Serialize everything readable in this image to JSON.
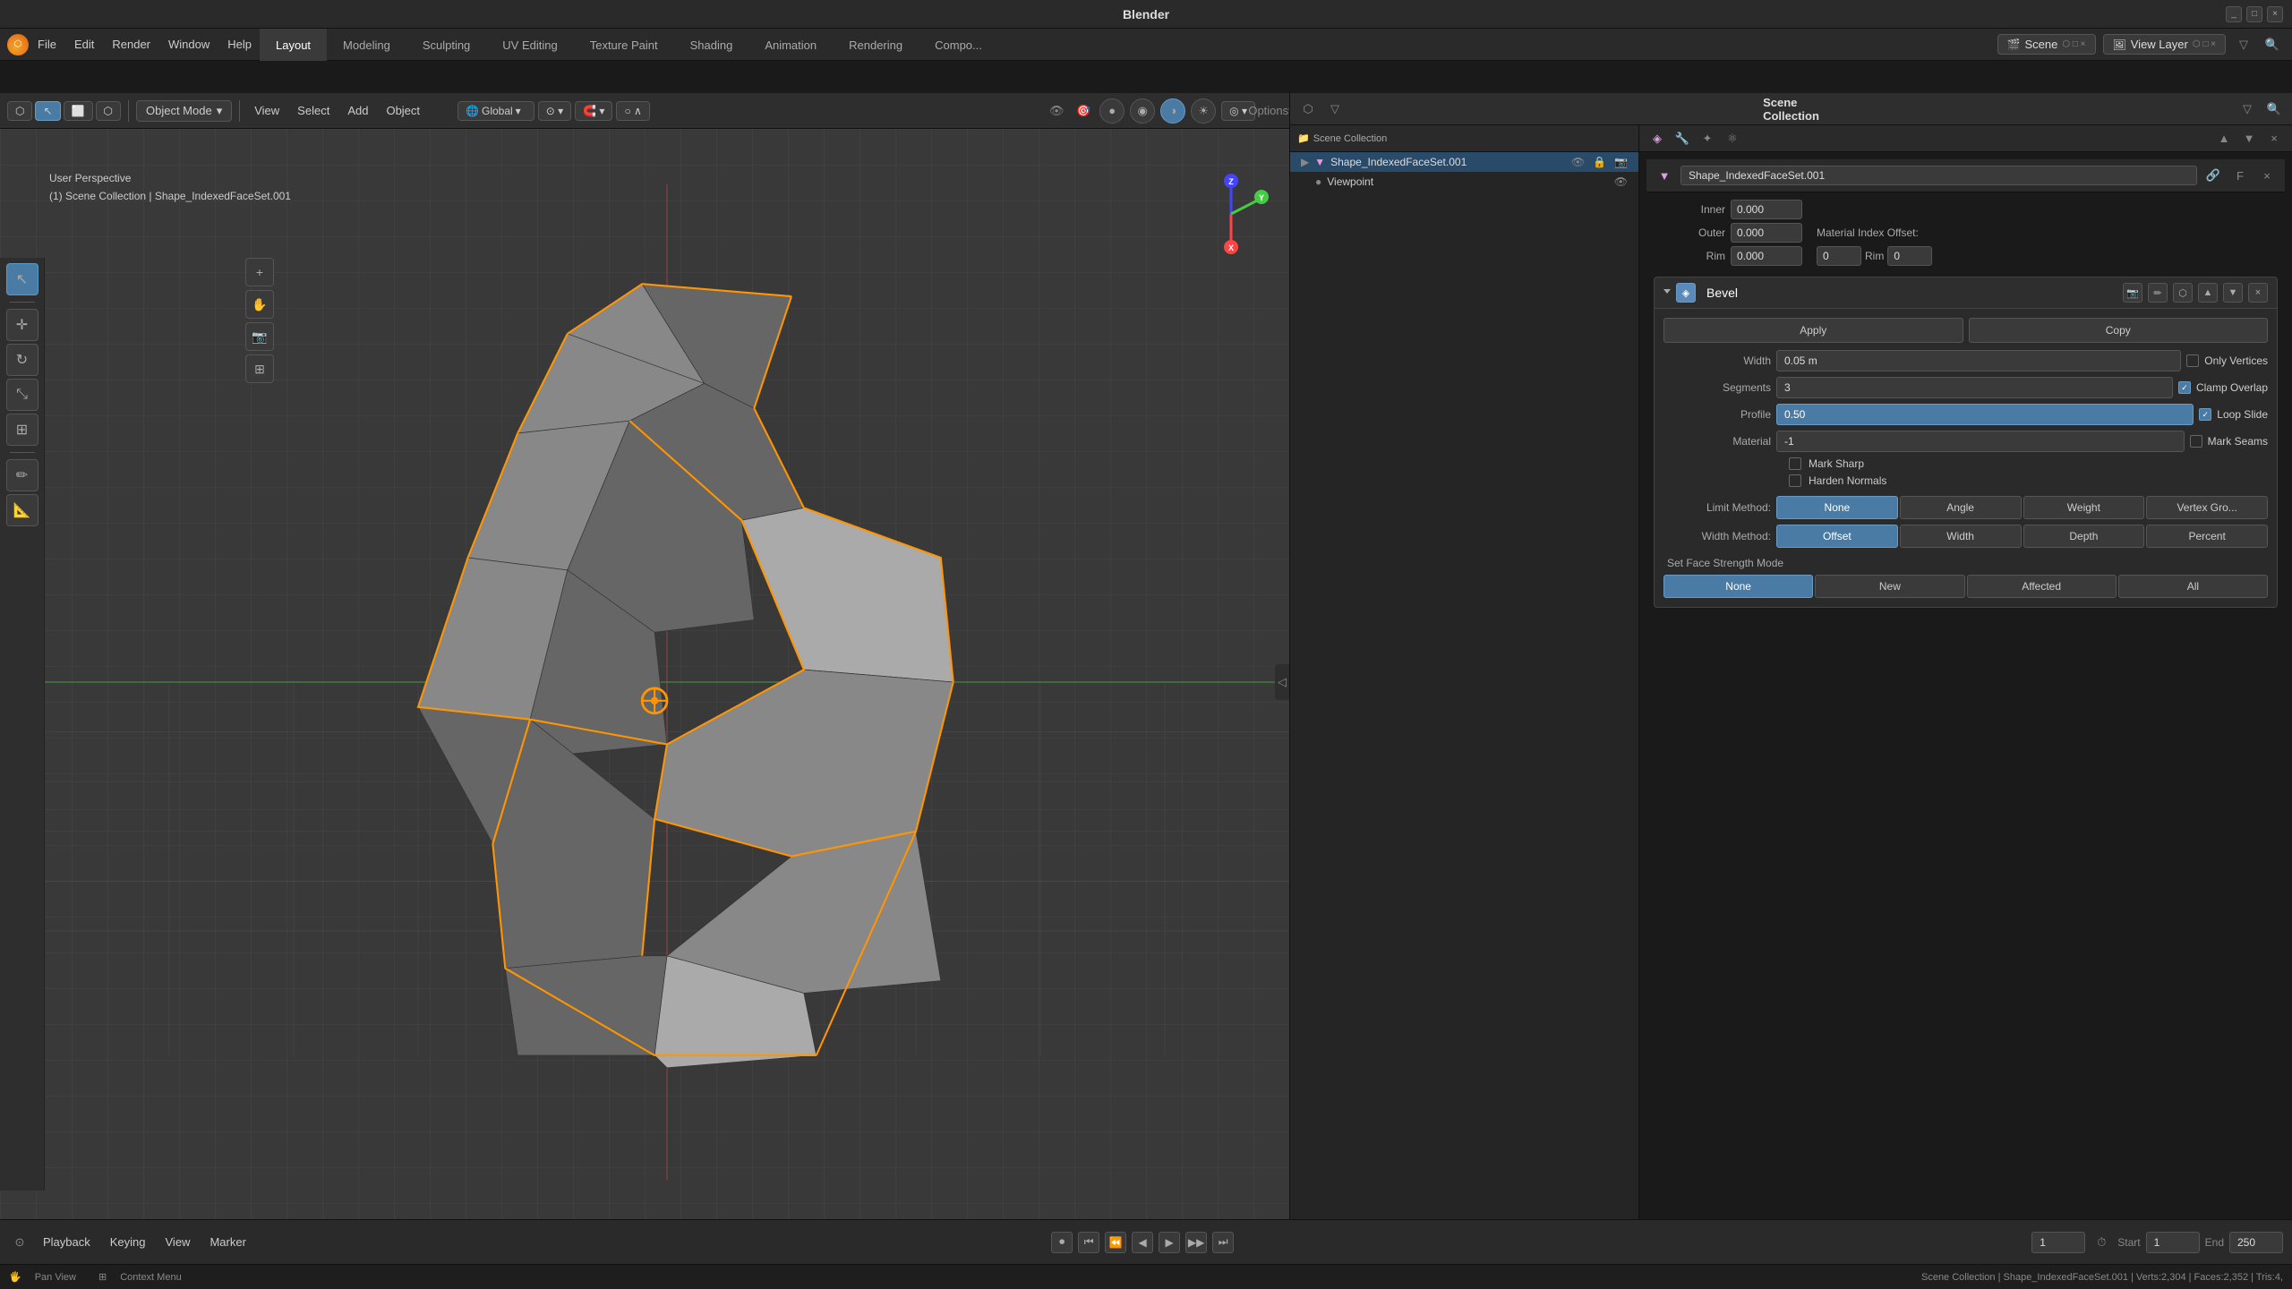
{
  "app": {
    "title": "Blender",
    "logo": "⬡"
  },
  "titlebar": {
    "title": "Blender",
    "controls": [
      "_",
      "□",
      "×"
    ]
  },
  "menubar": {
    "items": [
      "Blender",
      "File",
      "Edit",
      "Render",
      "Window",
      "Help"
    ]
  },
  "workspaceTabs": {
    "tabs": [
      "Layout",
      "Modeling",
      "Sculpting",
      "UV Editing",
      "Texture Paint",
      "Shading",
      "Animation",
      "Rendering",
      "Compositing"
    ],
    "active": "Layout"
  },
  "sceneHeader": {
    "sceneLabel": "Scene",
    "viewLayerLabel": "View Layer",
    "sceneIcon": "🎬",
    "viewLayerIcon": "🖼"
  },
  "viewport": {
    "mode": "Object Mode",
    "view": "User Perspective",
    "collection": "(1) Scene Collection | Shape_IndexedFaceSet.001",
    "header": {
      "global": "Global",
      "pivot": "⊙",
      "snap": "🧲",
      "proportional": "○",
      "viewMenu": "View",
      "selectMenu": "Select",
      "addMenu": "Add",
      "objectMenu": "Object",
      "options": "Options"
    },
    "shadingBtns": [
      "●",
      "⬡",
      "◉",
      "□"
    ],
    "overlayBtn": "Overlay",
    "gizmoBtn": "Gizmo"
  },
  "outliner": {
    "header": "Scene Collection",
    "items": [
      {
        "name": "Shape_IndexedFaceSet.001",
        "type": "mesh",
        "icon": "▼",
        "color": "purple",
        "selected": true,
        "visible": true
      },
      {
        "name": "Viewpoint",
        "type": "camera",
        "icon": "●",
        "color": "orange",
        "selected": false,
        "visible": true
      }
    ]
  },
  "properties": {
    "objectName": "Shape_IndexedFaceSet.001",
    "topSection": {
      "inner": {
        "label": "Inner",
        "value": "0.000"
      },
      "outer": {
        "label": "Outer",
        "value": "0.000"
      },
      "rim": {
        "label": "Rim",
        "value": "0.000"
      },
      "materialIndexOffset": {
        "label": "Material Index Offset:",
        "value": ""
      },
      "rimRight": {
        "label": "Rim",
        "value": "0"
      },
      "rimLeft": {
        "label": "Rim",
        "value": "0"
      }
    },
    "bevel": {
      "title": "Bevel",
      "applyBtn": "Apply",
      "copyBtn": "Copy",
      "fields": {
        "width": {
          "label": "Width",
          "value": "0.05 m"
        },
        "segments": {
          "label": "Segments",
          "value": "3"
        },
        "profile": {
          "label": "Profile",
          "value": "0.50",
          "active": true
        },
        "material": {
          "label": "Material",
          "value": "-1"
        }
      },
      "checkboxes": {
        "onlyVertices": {
          "label": "Only Vertices",
          "checked": false
        },
        "clampOverlap": {
          "label": "Clamp Overlap",
          "checked": true
        },
        "loopSlide": {
          "label": "Loop Slide",
          "checked": true
        },
        "markSeams": {
          "label": "Mark Seams",
          "checked": false
        },
        "markSharp": {
          "label": "Mark Sharp",
          "checked": false
        },
        "hardenNormals": {
          "label": "Harden Normals",
          "checked": false
        }
      },
      "limitMethod": {
        "label": "Limit Method:",
        "options": [
          "None",
          "Angle",
          "Weight",
          "Vertex Gro..."
        ],
        "active": "None"
      },
      "widthMethod": {
        "label": "Width Method:",
        "options": [
          "Offset",
          "Width",
          "Depth",
          "Percent"
        ],
        "active": "Offset"
      },
      "setFaceStrengthMode": {
        "label": "Set Face Strength Mode",
        "options": [
          "None",
          "New",
          "Affected",
          "All"
        ],
        "active": "None"
      }
    }
  },
  "timeline": {
    "playbackLabel": "Playback",
    "keyingLabel": "Keying",
    "viewLabel": "View",
    "markerLabel": "Marker",
    "currentFrame": "1",
    "startFrame": "1",
    "endFrame": "250",
    "controls": [
      "⏺",
      "⏮",
      "⏪",
      "⏴",
      "▶",
      "⏩",
      "⏭"
    ]
  },
  "statusbar": {
    "panView": "Pan View",
    "contextMenu": "Context Menu",
    "stats": "Scene Collection | Shape_IndexedFaceSet.001 | Verts:2,304 | Faces:2,352 | Tris:4,"
  }
}
